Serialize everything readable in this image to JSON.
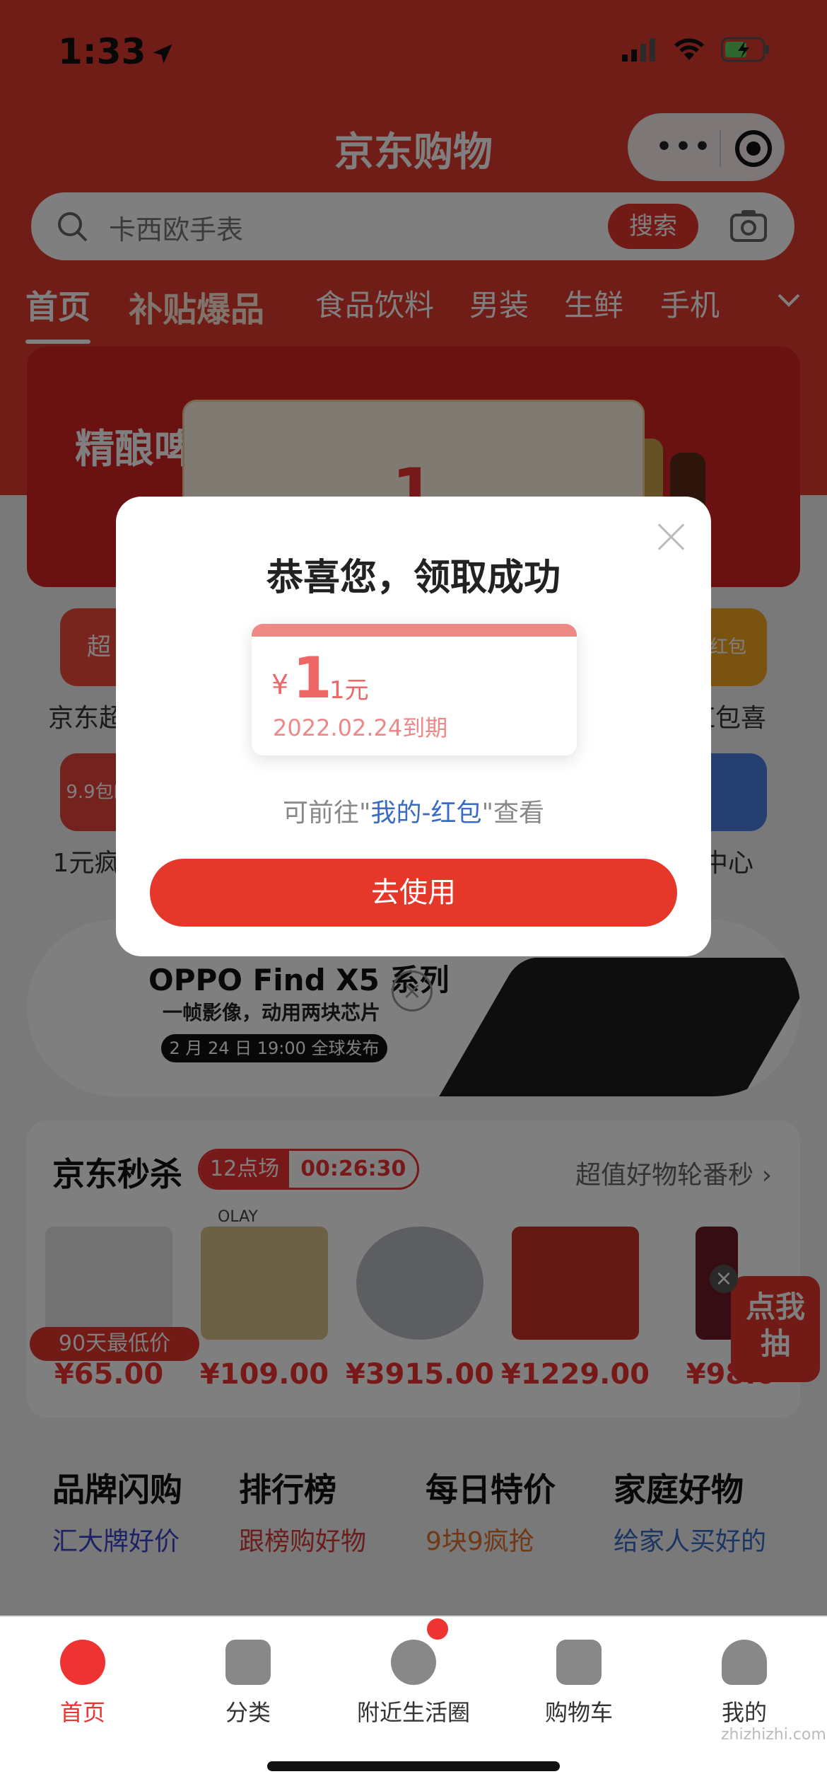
{
  "status_bar": {
    "time": "1:33"
  },
  "app": {
    "title": "京东购物"
  },
  "search": {
    "placeholder": "卡西欧手表",
    "button": "搜索"
  },
  "tabs": [
    "首页",
    "补贴爆品",
    "食品饮料",
    "男装",
    "生鲜",
    "手机"
  ],
  "banner": {
    "text": "精酿啤"
  },
  "ticket_number": "1",
  "icon_grid": {
    "row1": [
      "京东超市",
      "红包喜"
    ],
    "row1_badges": [
      "超",
      "红包"
    ],
    "row2": [
      "1元疯抢",
      "中心"
    ],
    "row2_badge": "9.9包邮"
  },
  "promo": {
    "title": "OPPO Find X5 系列",
    "subtitle": "一帧影像，动用两块芯片",
    "date": "2 月 24 日 19:00 全球发布"
  },
  "seckill": {
    "title": "京东秒杀",
    "session": "12点场",
    "countdown": "00:26:30",
    "more": "超值好物轮番秒",
    "low_tag": "90天最低价",
    "olay": "OLAY",
    "prices": [
      "¥65.00",
      "¥109.00",
      "¥3915.00",
      "¥1229.00",
      "¥98.0"
    ]
  },
  "lottery": {
    "line1": "点我",
    "line2": "抽"
  },
  "brands": [
    {
      "title": "品牌闪购",
      "sub": "汇大牌好价",
      "color": "#3a44c8"
    },
    {
      "title": "排行榜",
      "sub": "跟榜购好物",
      "color": "#d33a3a"
    },
    {
      "title": "每日特价",
      "sub": "9块9疯抢",
      "color": "#e0702a"
    },
    {
      "title": "家庭好物",
      "sub": "给家人买好的",
      "color": "#3a6bc4"
    }
  ],
  "tabbar": [
    "首页",
    "分类",
    "附近生活圈",
    "购物车",
    "我的"
  ],
  "modal": {
    "heading": "恭喜您，领取成功",
    "currency": "¥",
    "amount": "1",
    "unit": "1元",
    "expiry": "2022.02.24到期",
    "tip_prefix": "可前往\"",
    "tip_link": "我的-红包",
    "tip_suffix": "\"查看",
    "cta": "去使用"
  },
  "watermark": "zhizhizhi.com",
  "colors": {
    "brand_red": "#e5372c",
    "link_blue": "#3a6bc4"
  }
}
